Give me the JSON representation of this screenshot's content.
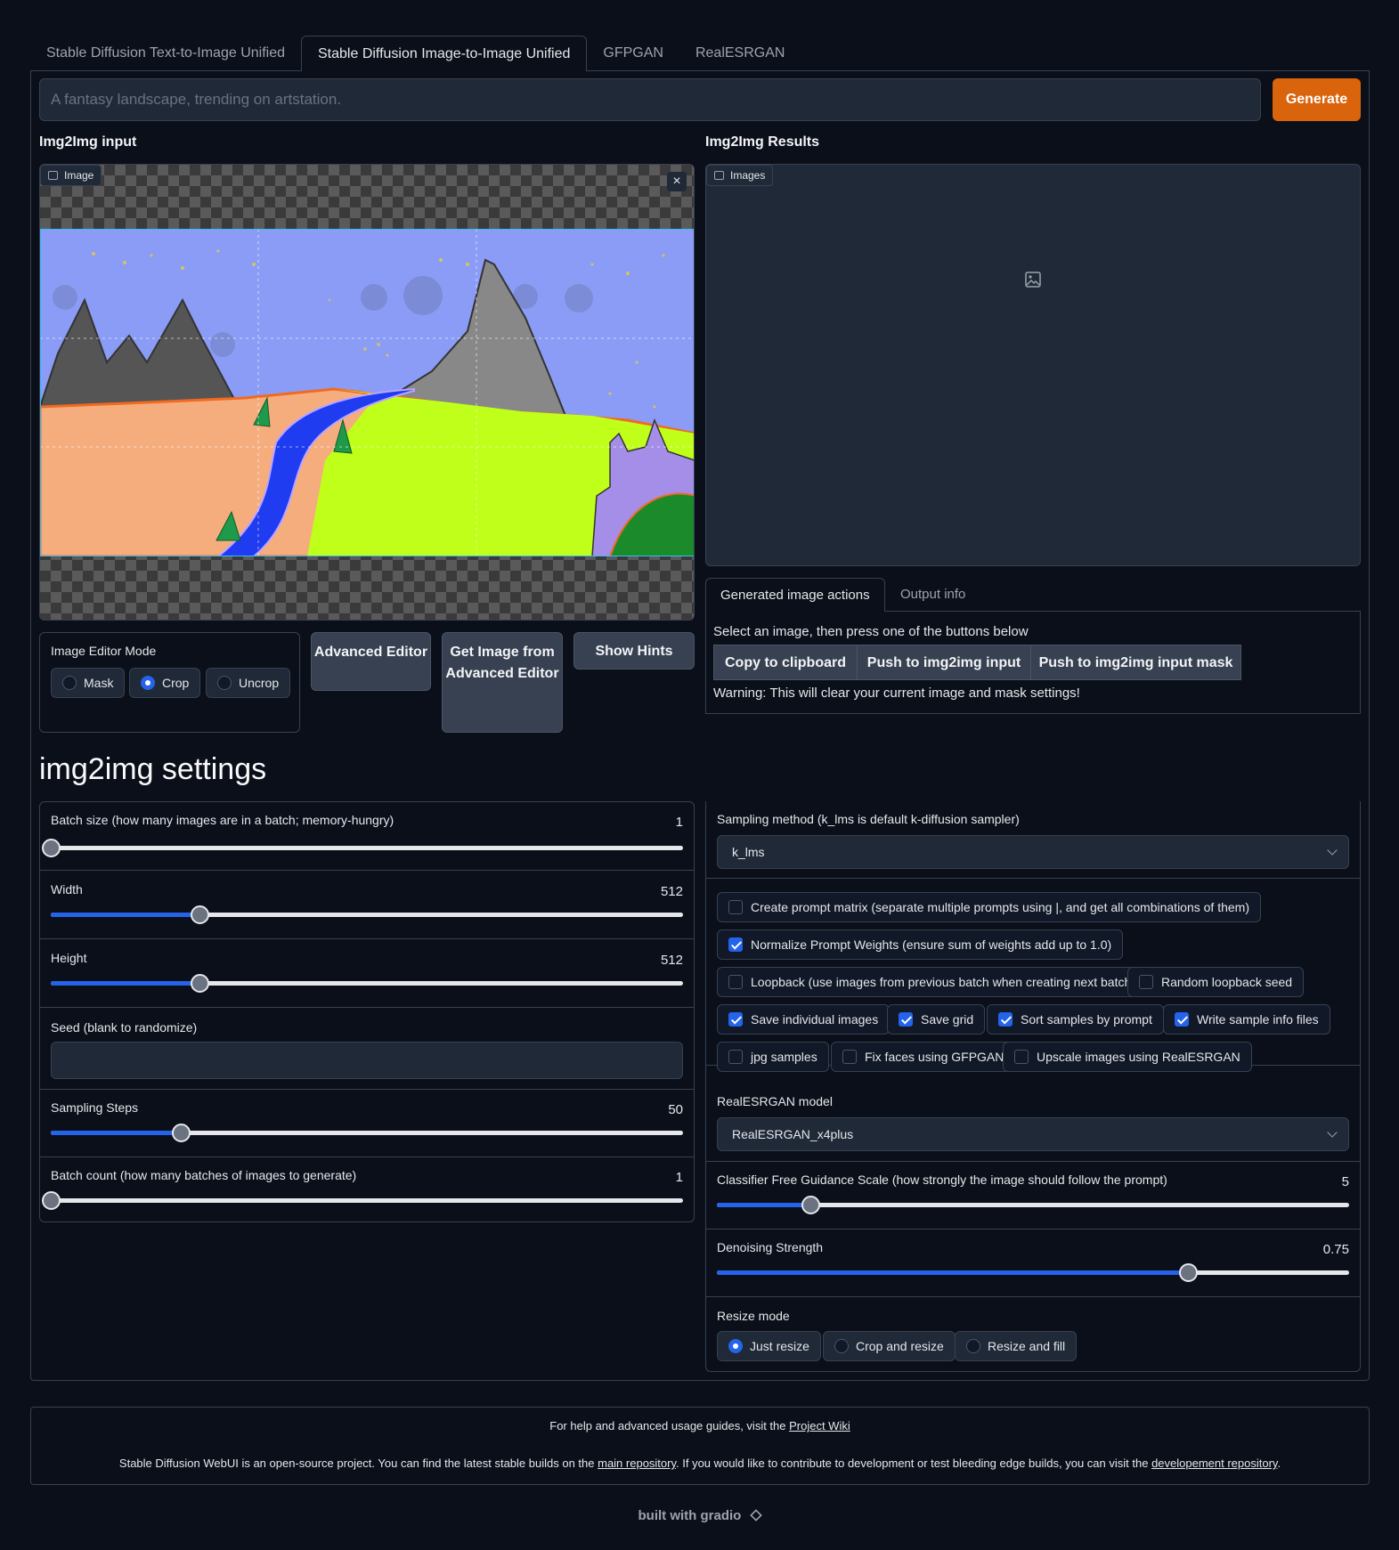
{
  "tabs": [
    "Stable Diffusion Text-to-Image Unified",
    "Stable Diffusion Image-to-Image Unified",
    "GFPGAN",
    "RealESRGAN"
  ],
  "prompt": {
    "placeholder": "A fantasy landscape, trending on artstation.",
    "value": ""
  },
  "generate_label": "Generate",
  "input_panel": {
    "title": "Img2Img input",
    "badge": "Image"
  },
  "results_panel": {
    "title": "Img2Img Results",
    "badge": "Images"
  },
  "editor": {
    "mode_label": "Image Editor Mode",
    "modes": [
      "Mask",
      "Crop",
      "Uncrop"
    ],
    "selected_mode": "Crop",
    "advanced_editor": "Advanced Editor",
    "get_image": "Get Image from Advanced Editor",
    "show_hints": "Show Hints"
  },
  "actions": {
    "tabs": [
      "Generated image actions",
      "Output info"
    ],
    "instruction": "Select an image, then press one of the buttons below",
    "buttons": [
      "Copy to clipboard",
      "Push to img2img input",
      "Push to img2img input mask"
    ],
    "warning": "Warning: This will clear your current image and mask settings!"
  },
  "settings_title": "img2img settings",
  "left_settings": {
    "batch_size": {
      "label": "Batch size (how many images are in a batch; memory-hungry)",
      "value": "1",
      "fraction": 0.0
    },
    "width": {
      "label": "Width",
      "value": "512",
      "fraction": 0.235
    },
    "height": {
      "label": "Height",
      "value": "512",
      "fraction": 0.235
    },
    "seed": {
      "label": "Seed (blank to randomize)",
      "value": ""
    },
    "steps": {
      "label": "Sampling Steps",
      "value": "50",
      "fraction": 0.205
    },
    "batch_count": {
      "label": "Batch count (how many batches of images to generate)",
      "value": "1",
      "fraction": 0.0
    }
  },
  "right_settings": {
    "sampler": {
      "label": "Sampling method (k_lms is default k-diffusion sampler)",
      "value": "k_lms"
    },
    "checks": [
      {
        "label": "Create prompt matrix (separate multiple prompts using |, and get all combinations of them)",
        "checked": false
      },
      {
        "label": "Normalize Prompt Weights (ensure sum of weights add up to 1.0)",
        "checked": true
      },
      {
        "label": "Loopback (use images from previous batch when creating next batch)",
        "checked": false
      },
      {
        "label": "Random loopback seed",
        "checked": false
      },
      {
        "label": "Save individual images",
        "checked": true
      },
      {
        "label": "Save grid",
        "checked": true
      },
      {
        "label": "Sort samples by prompt",
        "checked": true
      },
      {
        "label": "Write sample info files",
        "checked": true
      },
      {
        "label": "jpg samples",
        "checked": false
      },
      {
        "label": "Fix faces using GFPGAN",
        "checked": false
      },
      {
        "label": "Upscale images using RealESRGAN",
        "checked": false
      }
    ],
    "esrgan_model": {
      "label": "RealESRGAN model",
      "value": "RealESRGAN_x4plus"
    },
    "cfg": {
      "label": "Classifier Free Guidance Scale (how strongly the image should follow the prompt)",
      "value": "5",
      "fraction": 0.148
    },
    "denoise": {
      "label": "Denoising Strength",
      "value": "0.75",
      "fraction": 0.745
    },
    "resize_mode": {
      "label": "Resize mode",
      "options": [
        "Just resize",
        "Crop and resize",
        "Resize and fill"
      ],
      "selected": "Just resize"
    }
  },
  "footer": {
    "line1_prefix": "For help and advanced usage guides, visit the ",
    "line1_link": "Project Wiki",
    "line2_a": "Stable Diffusion WebUI is an open-source project. You can find the latest stable builds on the ",
    "line2_link1": "main repository",
    "line2_b": ". If you would like to contribute to development or test bleeding edge builds, you can visit the ",
    "line2_link2": "developement repository",
    "line2_c": "."
  },
  "built_with": "built with gradio",
  "colors": {
    "accent": "#d9640c",
    "slider": "#2563eb",
    "background": "#0b0f19"
  }
}
